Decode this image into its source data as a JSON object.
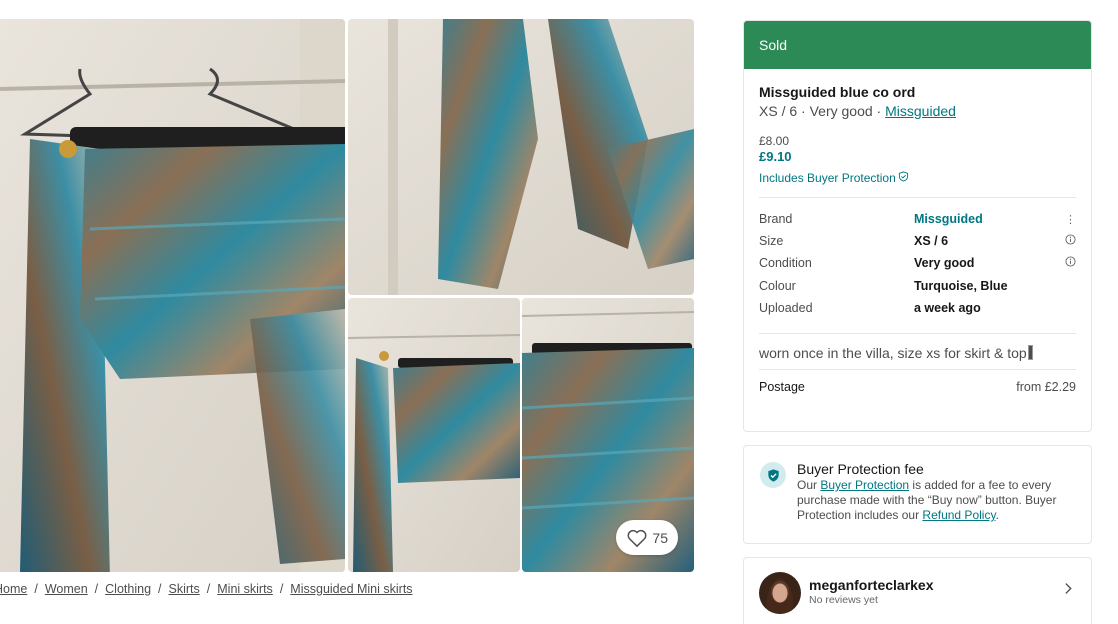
{
  "gallery": {
    "favourite_count": "75",
    "icons": {
      "favourite": "heart-outline-icon"
    }
  },
  "breadcrumb": {
    "items": [
      "Home",
      "Women",
      "Clothing",
      "Skirts",
      "Mini skirts",
      "Missguided Mini skirts"
    ],
    "separator": "/"
  },
  "item": {
    "status": "Sold",
    "title": "Missguided blue co ord",
    "size": "XS / 6",
    "condition_short": "Very good",
    "brand_link": "Missguided",
    "price": "£8.00",
    "total_price": "£9.10",
    "buyer_protection_note": "Includes Buyer Protection",
    "details": [
      {
        "key": "Brand",
        "value": "Missguided"
      },
      {
        "key": "Size",
        "value": "XS / 6"
      },
      {
        "key": "Condition",
        "value": "Very good"
      },
      {
        "key": "Colour",
        "value": "Turquoise, Blue"
      },
      {
        "key": "Uploaded",
        "value": "a week ago"
      }
    ],
    "description": "worn once in the villa, size xs for skirt & top",
    "postage_label": "Postage",
    "postage_value": "from £2.29"
  },
  "buyer_protection": {
    "title": "Buyer Protection fee",
    "text_1": "Our ",
    "link_1": "Buyer Protection",
    "text_2": " is added for a fee to every purchase made with the “Buy now” button. Buyer Protection includes our ",
    "link_2": "Refund Policy",
    "text_3": "."
  },
  "seller": {
    "username": "meganforteclarkex",
    "reviews": "No reviews yet"
  },
  "colors": {
    "sold_banner": "#2b8a56",
    "accent": "#007782",
    "border": "#e6e6e6"
  }
}
